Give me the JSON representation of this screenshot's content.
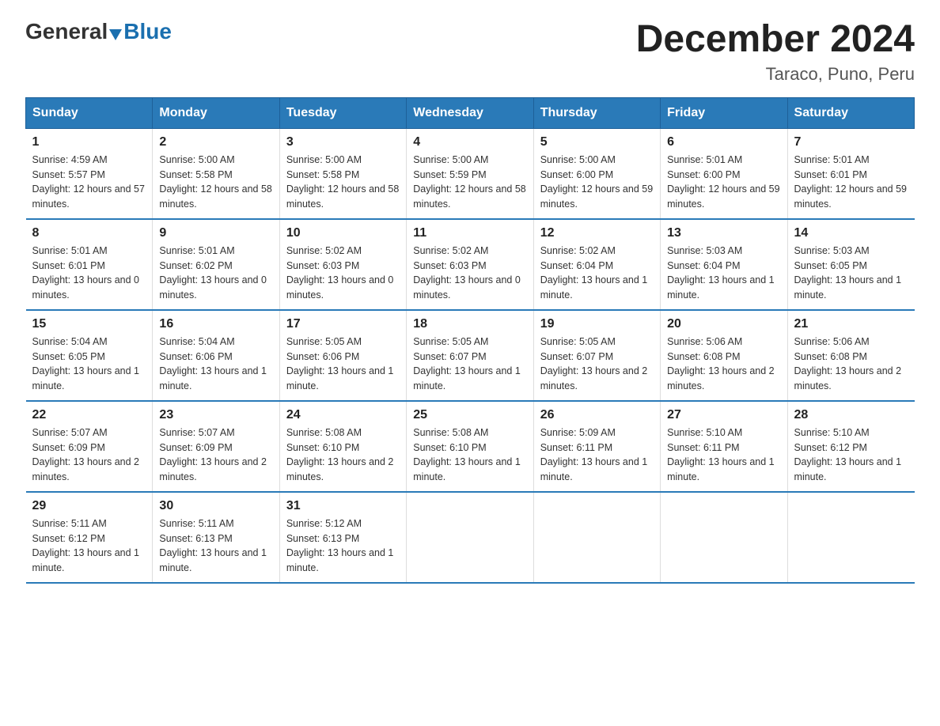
{
  "logo": {
    "general": "General",
    "blue": "Blue"
  },
  "title": "December 2024",
  "subtitle": "Taraco, Puno, Peru",
  "days_header": [
    "Sunday",
    "Monday",
    "Tuesday",
    "Wednesday",
    "Thursday",
    "Friday",
    "Saturday"
  ],
  "weeks": [
    [
      {
        "num": "1",
        "sunrise": "4:59 AM",
        "sunset": "5:57 PM",
        "daylight": "12 hours and 57 minutes."
      },
      {
        "num": "2",
        "sunrise": "5:00 AM",
        "sunset": "5:58 PM",
        "daylight": "12 hours and 58 minutes."
      },
      {
        "num": "3",
        "sunrise": "5:00 AM",
        "sunset": "5:58 PM",
        "daylight": "12 hours and 58 minutes."
      },
      {
        "num": "4",
        "sunrise": "5:00 AM",
        "sunset": "5:59 PM",
        "daylight": "12 hours and 58 minutes."
      },
      {
        "num": "5",
        "sunrise": "5:00 AM",
        "sunset": "6:00 PM",
        "daylight": "12 hours and 59 minutes."
      },
      {
        "num": "6",
        "sunrise": "5:01 AM",
        "sunset": "6:00 PM",
        "daylight": "12 hours and 59 minutes."
      },
      {
        "num": "7",
        "sunrise": "5:01 AM",
        "sunset": "6:01 PM",
        "daylight": "12 hours and 59 minutes."
      }
    ],
    [
      {
        "num": "8",
        "sunrise": "5:01 AM",
        "sunset": "6:01 PM",
        "daylight": "13 hours and 0 minutes."
      },
      {
        "num": "9",
        "sunrise": "5:01 AM",
        "sunset": "6:02 PM",
        "daylight": "13 hours and 0 minutes."
      },
      {
        "num": "10",
        "sunrise": "5:02 AM",
        "sunset": "6:03 PM",
        "daylight": "13 hours and 0 minutes."
      },
      {
        "num": "11",
        "sunrise": "5:02 AM",
        "sunset": "6:03 PM",
        "daylight": "13 hours and 0 minutes."
      },
      {
        "num": "12",
        "sunrise": "5:02 AM",
        "sunset": "6:04 PM",
        "daylight": "13 hours and 1 minute."
      },
      {
        "num": "13",
        "sunrise": "5:03 AM",
        "sunset": "6:04 PM",
        "daylight": "13 hours and 1 minute."
      },
      {
        "num": "14",
        "sunrise": "5:03 AM",
        "sunset": "6:05 PM",
        "daylight": "13 hours and 1 minute."
      }
    ],
    [
      {
        "num": "15",
        "sunrise": "5:04 AM",
        "sunset": "6:05 PM",
        "daylight": "13 hours and 1 minute."
      },
      {
        "num": "16",
        "sunrise": "5:04 AM",
        "sunset": "6:06 PM",
        "daylight": "13 hours and 1 minute."
      },
      {
        "num": "17",
        "sunrise": "5:05 AM",
        "sunset": "6:06 PM",
        "daylight": "13 hours and 1 minute."
      },
      {
        "num": "18",
        "sunrise": "5:05 AM",
        "sunset": "6:07 PM",
        "daylight": "13 hours and 1 minute."
      },
      {
        "num": "19",
        "sunrise": "5:05 AM",
        "sunset": "6:07 PM",
        "daylight": "13 hours and 2 minutes."
      },
      {
        "num": "20",
        "sunrise": "5:06 AM",
        "sunset": "6:08 PM",
        "daylight": "13 hours and 2 minutes."
      },
      {
        "num": "21",
        "sunrise": "5:06 AM",
        "sunset": "6:08 PM",
        "daylight": "13 hours and 2 minutes."
      }
    ],
    [
      {
        "num": "22",
        "sunrise": "5:07 AM",
        "sunset": "6:09 PM",
        "daylight": "13 hours and 2 minutes."
      },
      {
        "num": "23",
        "sunrise": "5:07 AM",
        "sunset": "6:09 PM",
        "daylight": "13 hours and 2 minutes."
      },
      {
        "num": "24",
        "sunrise": "5:08 AM",
        "sunset": "6:10 PM",
        "daylight": "13 hours and 2 minutes."
      },
      {
        "num": "25",
        "sunrise": "5:08 AM",
        "sunset": "6:10 PM",
        "daylight": "13 hours and 1 minute."
      },
      {
        "num": "26",
        "sunrise": "5:09 AM",
        "sunset": "6:11 PM",
        "daylight": "13 hours and 1 minute."
      },
      {
        "num": "27",
        "sunrise": "5:10 AM",
        "sunset": "6:11 PM",
        "daylight": "13 hours and 1 minute."
      },
      {
        "num": "28",
        "sunrise": "5:10 AM",
        "sunset": "6:12 PM",
        "daylight": "13 hours and 1 minute."
      }
    ],
    [
      {
        "num": "29",
        "sunrise": "5:11 AM",
        "sunset": "6:12 PM",
        "daylight": "13 hours and 1 minute."
      },
      {
        "num": "30",
        "sunrise": "5:11 AM",
        "sunset": "6:13 PM",
        "daylight": "13 hours and 1 minute."
      },
      {
        "num": "31",
        "sunrise": "5:12 AM",
        "sunset": "6:13 PM",
        "daylight": "13 hours and 1 minute."
      },
      null,
      null,
      null,
      null
    ]
  ]
}
